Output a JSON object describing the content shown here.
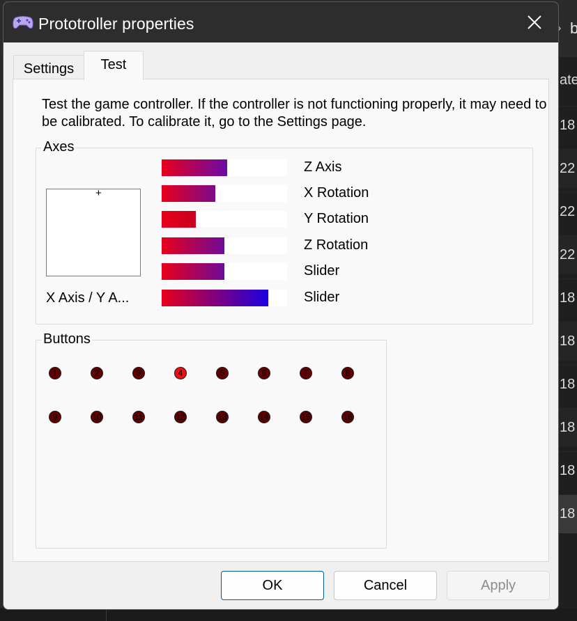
{
  "background": {
    "header_text": "b",
    "column_header": "ate",
    "rows": [
      "18",
      "22",
      "22",
      "22",
      "18",
      "18",
      "18",
      "18",
      "18",
      "18"
    ]
  },
  "dialog": {
    "title": "Prototroller properties",
    "title_icon": "gamepad-icon",
    "close_icon": "close-icon",
    "tabs": [
      {
        "label": "Settings",
        "active": false
      },
      {
        "label": "Test",
        "active": true
      }
    ],
    "description": "Test the game controller.  If the controller is not functioning properly, it may need to be calibrated.  To calibrate it, go to the Settings page.",
    "axes": {
      "title": "Axes",
      "xy_label": "X Axis / Y A...",
      "bars": [
        {
          "label": "Z Axis",
          "value": 0.52,
          "end_color": "#6a0aa8"
        },
        {
          "label": "X Rotation",
          "value": 0.43,
          "end_color": "#7a0a8c"
        },
        {
          "label": "Y Rotation",
          "value": 0.27,
          "end_color": "#c8001e"
        },
        {
          "label": "Z Rotation",
          "value": 0.5,
          "end_color": "#6e0a98"
        },
        {
          "label": "Slider",
          "value": 0.5,
          "end_color": "#6e0a98"
        },
        {
          "label": "Slider",
          "value": 0.85,
          "end_color": "#1a00e0"
        }
      ]
    },
    "buttons": {
      "title": "Buttons",
      "items": [
        {
          "label": "1",
          "pressed": false
        },
        {
          "label": "2",
          "pressed": false
        },
        {
          "label": "3",
          "pressed": false
        },
        {
          "label": "4",
          "pressed": true
        },
        {
          "label": "5",
          "pressed": false
        },
        {
          "label": "6",
          "pressed": false
        },
        {
          "label": "7",
          "pressed": false
        },
        {
          "label": "8",
          "pressed": false
        },
        {
          "label": "9",
          "pressed": false
        },
        {
          "label": "10",
          "pressed": false
        },
        {
          "label": "11",
          "pressed": false
        },
        {
          "label": "12",
          "pressed": false
        },
        {
          "label": "13",
          "pressed": false
        },
        {
          "label": "14",
          "pressed": false
        },
        {
          "label": "15",
          "pressed": false
        },
        {
          "label": "16",
          "pressed": false
        }
      ]
    },
    "footer": {
      "ok_label": "OK",
      "cancel_label": "Cancel",
      "apply_label": "Apply"
    }
  },
  "colors": {
    "bar_start": "#e8001a",
    "button_off": "#600000",
    "button_on": "#e81010"
  }
}
